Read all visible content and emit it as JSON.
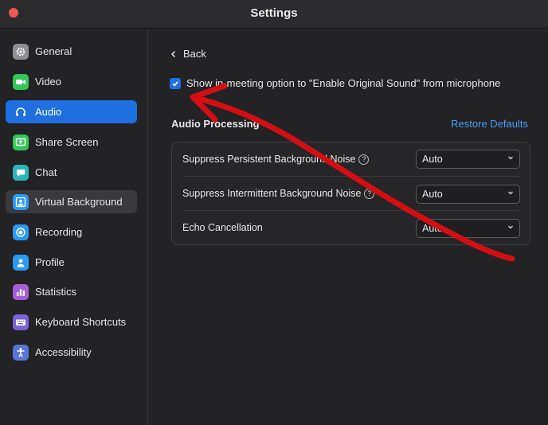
{
  "window": {
    "title": "Settings"
  },
  "sidebar": {
    "items": [
      {
        "label": "General",
        "icon": "gear-icon",
        "color": "#8e8e93"
      },
      {
        "label": "Video",
        "icon": "video-camera-icon",
        "color": "#34c759"
      },
      {
        "label": "Audio",
        "icon": "headphones-icon",
        "color": "#1f6fe0"
      },
      {
        "label": "Share Screen",
        "icon": "share-screen-icon",
        "color": "#34c759"
      },
      {
        "label": "Chat",
        "icon": "chat-bubble-icon",
        "color": "#2bb5b5"
      },
      {
        "label": "Virtual Background",
        "icon": "person-background-icon",
        "color": "#2b9af3"
      },
      {
        "label": "Recording",
        "icon": "record-icon",
        "color": "#2b9af3"
      },
      {
        "label": "Profile",
        "icon": "person-icon",
        "color": "#2b9af3"
      },
      {
        "label": "Statistics",
        "icon": "bar-chart-icon",
        "color": "#a55fd6"
      },
      {
        "label": "Keyboard Shortcuts",
        "icon": "keyboard-icon",
        "color": "#7b61d6"
      },
      {
        "label": "Accessibility",
        "icon": "accessibility-icon",
        "color": "#5a73d6"
      }
    ],
    "active": "Audio",
    "hovered": "Virtual Background"
  },
  "main": {
    "back_label": "Back",
    "original_sound": {
      "checked": true,
      "label": "Show in-meeting option to \"Enable Original Sound\" from microphone"
    },
    "section_title": "Audio Processing",
    "restore_label": "Restore Defaults",
    "rows": [
      {
        "label": "Suppress Persistent Background Noise",
        "help": true,
        "value": "Auto"
      },
      {
        "label": "Suppress Intermittent Background Noise",
        "help": true,
        "value": "Auto"
      },
      {
        "label": "Echo Cancellation",
        "help": false,
        "value": "Auto"
      }
    ]
  },
  "colors": {
    "accent": "#1f6fe0",
    "link": "#4a9bf5",
    "annotation": "#d40f14"
  }
}
